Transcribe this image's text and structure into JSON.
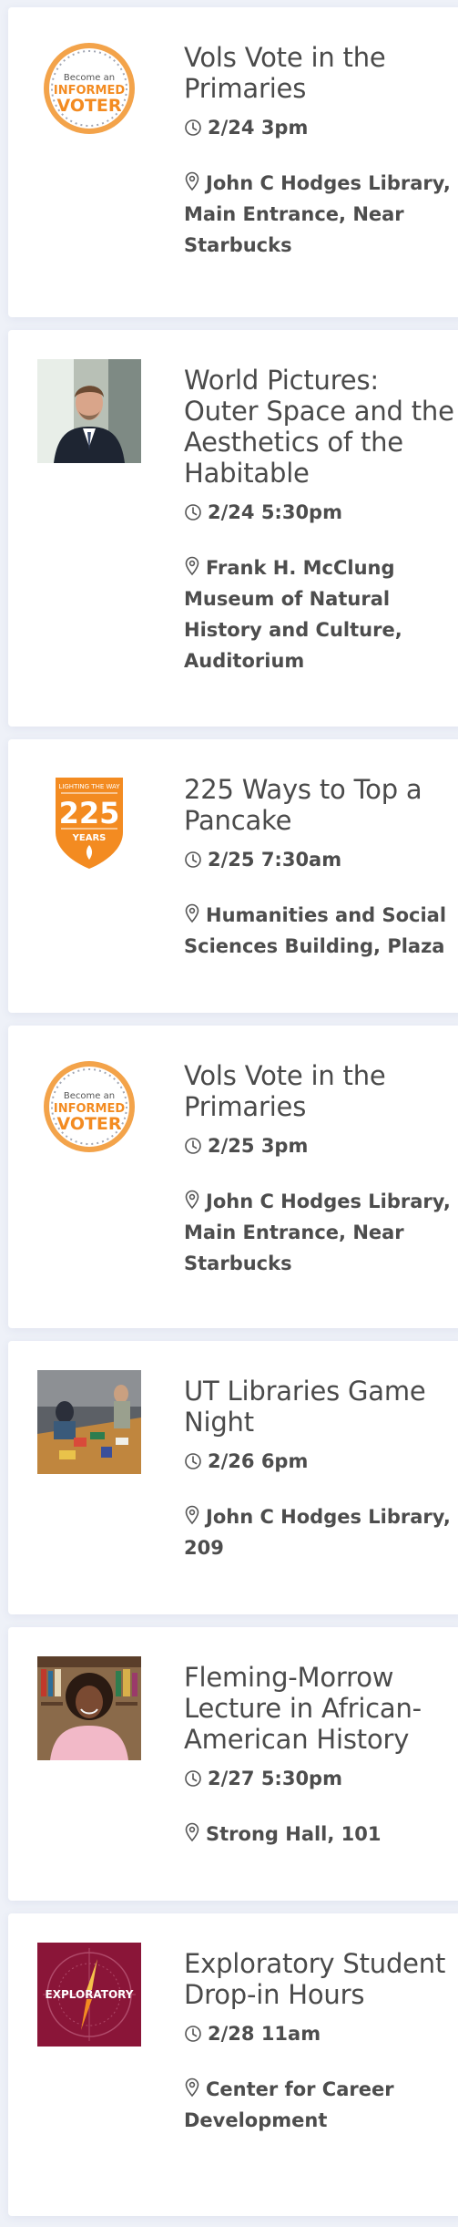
{
  "events": [
    {
      "title": "Vols Vote in the Primaries",
      "datetime": "2/24 3pm",
      "location": "John C Hodges Library, Main Entrance, Near Starbucks",
      "image": "informed-voter-badge",
      "image_text": [
        "Become an",
        "INFORMED",
        "VOTER"
      ]
    },
    {
      "title": "World Pictures: Outer Space and the Aesthetics of the Habitable",
      "datetime": "2/24 5:30pm",
      "location": "Frank H. McClung Museum of Natural History and Culture, Auditorium",
      "image": "speaker-portrait-photo"
    },
    {
      "title": "225 Ways to Top a Pancake",
      "datetime": "2/25 7:30am",
      "location": "Humanities and Social Sciences Building, Plaza",
      "image": "ut-225-years-shield",
      "image_text": [
        "LIGHTING THE WAY",
        "225",
        "YEARS"
      ]
    },
    {
      "title": "Vols Vote in the Primaries",
      "datetime": "2/25 3pm",
      "location": "John C Hodges Library, Main Entrance, Near Starbucks",
      "image": "informed-voter-badge",
      "image_text": [
        "Become an",
        "INFORMED",
        "VOTER"
      ]
    },
    {
      "title": "UT Libraries Game Night",
      "datetime": "2/26 6pm",
      "location": "John C Hodges Library, 209",
      "image": "game-night-photo"
    },
    {
      "title": "Fleming-Morrow Lecture in African-American History",
      "datetime": "2/27 5:30pm",
      "location": "Strong Hall, 101",
      "image": "lecturer-portrait-photo"
    },
    {
      "title": "Exploratory Student Drop-in Hours",
      "datetime": "2/28 11am",
      "location": "Center for Career Development",
      "image": "exploratory-compass-graphic",
      "image_text": [
        "EXPLORATORY"
      ]
    }
  ],
  "icons": {
    "time": "clock-icon",
    "location": "map-pin-icon"
  },
  "colors": {
    "background": "#eef1f8",
    "card": "#ffffff",
    "text": "#4a4a4a",
    "ut_orange": "#f38b21",
    "maroon": "#8a1538"
  }
}
